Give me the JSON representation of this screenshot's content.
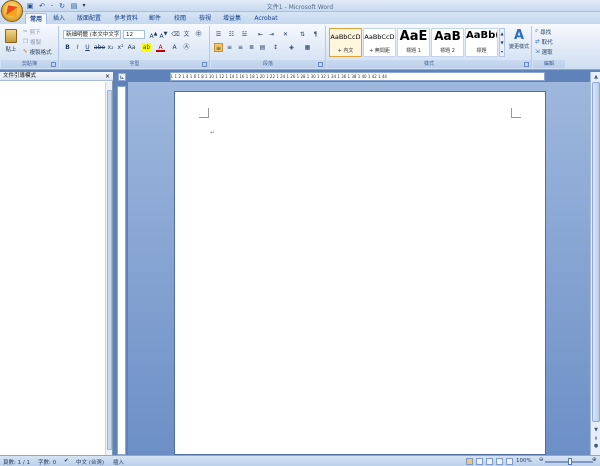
{
  "window": {
    "title": "文件1 - Microsoft Word"
  },
  "tabs": [
    {
      "label": "常用",
      "active": true
    },
    {
      "label": "插入"
    },
    {
      "label": "版面配置"
    },
    {
      "label": "參考資料"
    },
    {
      "label": "郵件"
    },
    {
      "label": "校閱"
    },
    {
      "label": "檢視"
    },
    {
      "label": "增益集"
    },
    {
      "label": "Acrobat"
    }
  ],
  "clipboard": {
    "paste": "貼上",
    "cut": "剪下",
    "copy": "複製",
    "format_painter": "複製格式",
    "group": "剪貼簿"
  },
  "font": {
    "name": "新細明體 (本文中文字",
    "size": "12",
    "group": "字型"
  },
  "paragraph": {
    "group": "段落"
  },
  "styles": {
    "group": "樣式",
    "items": [
      {
        "sample": "AaBbCcD",
        "name": "+ 內文",
        "selected": true
      },
      {
        "sample": "AaBbCcD",
        "name": "+ 無間距"
      },
      {
        "sample": "AaE",
        "name": "標題 1"
      },
      {
        "sample": "AaB",
        "name": "標題 2"
      },
      {
        "sample": "AaBb(",
        "name": "標題"
      }
    ],
    "change_styles": "變更樣式"
  },
  "editing": {
    "find": "尋找",
    "replace": "取代",
    "select": "選取",
    "group": "編輯"
  },
  "nav_pane": {
    "title": "文件引導模式",
    "close": "×"
  },
  "ruler": {
    "ticks": "L  1  2  1  4  1  6  1  8  1  10  1  12  1  14  1  16  1  18  1  20  1  22  1  24  1  26  1  28  1  30  1  32  1  34  1  36  1  38  1  40  1  42  1  44"
  },
  "status": {
    "page": "頁數: 1 / 1",
    "words": "字數: 0",
    "language": "中文 (台灣)",
    "mode": "插入",
    "zoom": "100%"
  },
  "colors": {
    "ribbon_bg": "#dfe9f6",
    "doc_bg": "#8ea8d4",
    "accent": "#15428b"
  }
}
